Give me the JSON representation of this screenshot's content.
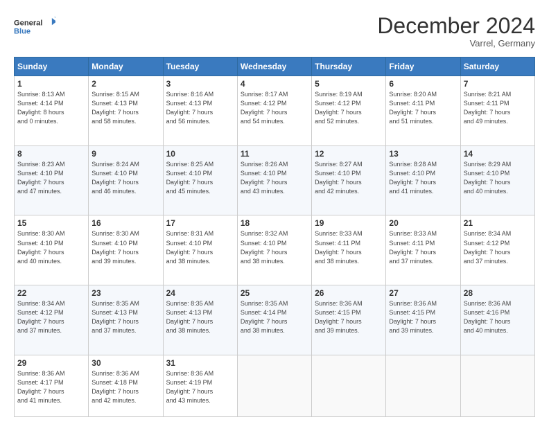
{
  "logo": {
    "line1": "General",
    "line2": "Blue"
  },
  "title": "December 2024",
  "location": "Varrel, Germany",
  "days_header": [
    "Sunday",
    "Monday",
    "Tuesday",
    "Wednesday",
    "Thursday",
    "Friday",
    "Saturday"
  ],
  "weeks": [
    [
      {
        "day": "1",
        "sunrise": "8:13 AM",
        "sunset": "4:14 PM",
        "daylight": "8 hours and 0 minutes."
      },
      {
        "day": "2",
        "sunrise": "8:15 AM",
        "sunset": "4:13 PM",
        "daylight": "7 hours and 58 minutes."
      },
      {
        "day": "3",
        "sunrise": "8:16 AM",
        "sunset": "4:13 PM",
        "daylight": "7 hours and 56 minutes."
      },
      {
        "day": "4",
        "sunrise": "8:17 AM",
        "sunset": "4:12 PM",
        "daylight": "7 hours and 54 minutes."
      },
      {
        "day": "5",
        "sunrise": "8:19 AM",
        "sunset": "4:12 PM",
        "daylight": "7 hours and 52 minutes."
      },
      {
        "day": "6",
        "sunrise": "8:20 AM",
        "sunset": "4:11 PM",
        "daylight": "7 hours and 51 minutes."
      },
      {
        "day": "7",
        "sunrise": "8:21 AM",
        "sunset": "4:11 PM",
        "daylight": "7 hours and 49 minutes."
      }
    ],
    [
      {
        "day": "8",
        "sunrise": "8:23 AM",
        "sunset": "4:10 PM",
        "daylight": "7 hours and 47 minutes."
      },
      {
        "day": "9",
        "sunrise": "8:24 AM",
        "sunset": "4:10 PM",
        "daylight": "7 hours and 46 minutes."
      },
      {
        "day": "10",
        "sunrise": "8:25 AM",
        "sunset": "4:10 PM",
        "daylight": "7 hours and 45 minutes."
      },
      {
        "day": "11",
        "sunrise": "8:26 AM",
        "sunset": "4:10 PM",
        "daylight": "7 hours and 43 minutes."
      },
      {
        "day": "12",
        "sunrise": "8:27 AM",
        "sunset": "4:10 PM",
        "daylight": "7 hours and 42 minutes."
      },
      {
        "day": "13",
        "sunrise": "8:28 AM",
        "sunset": "4:10 PM",
        "daylight": "7 hours and 41 minutes."
      },
      {
        "day": "14",
        "sunrise": "8:29 AM",
        "sunset": "4:10 PM",
        "daylight": "7 hours and 40 minutes."
      }
    ],
    [
      {
        "day": "15",
        "sunrise": "8:30 AM",
        "sunset": "4:10 PM",
        "daylight": "7 hours and 40 minutes."
      },
      {
        "day": "16",
        "sunrise": "8:30 AM",
        "sunset": "4:10 PM",
        "daylight": "7 hours and 39 minutes."
      },
      {
        "day": "17",
        "sunrise": "8:31 AM",
        "sunset": "4:10 PM",
        "daylight": "7 hours and 38 minutes."
      },
      {
        "day": "18",
        "sunrise": "8:32 AM",
        "sunset": "4:10 PM",
        "daylight": "7 hours and 38 minutes."
      },
      {
        "day": "19",
        "sunrise": "8:33 AM",
        "sunset": "4:11 PM",
        "daylight": "7 hours and 38 minutes."
      },
      {
        "day": "20",
        "sunrise": "8:33 AM",
        "sunset": "4:11 PM",
        "daylight": "7 hours and 37 minutes."
      },
      {
        "day": "21",
        "sunrise": "8:34 AM",
        "sunset": "4:12 PM",
        "daylight": "7 hours and 37 minutes."
      }
    ],
    [
      {
        "day": "22",
        "sunrise": "8:34 AM",
        "sunset": "4:12 PM",
        "daylight": "7 hours and 37 minutes."
      },
      {
        "day": "23",
        "sunrise": "8:35 AM",
        "sunset": "4:13 PM",
        "daylight": "7 hours and 37 minutes."
      },
      {
        "day": "24",
        "sunrise": "8:35 AM",
        "sunset": "4:13 PM",
        "daylight": "7 hours and 38 minutes."
      },
      {
        "day": "25",
        "sunrise": "8:35 AM",
        "sunset": "4:14 PM",
        "daylight": "7 hours and 38 minutes."
      },
      {
        "day": "26",
        "sunrise": "8:36 AM",
        "sunset": "4:15 PM",
        "daylight": "7 hours and 39 minutes."
      },
      {
        "day": "27",
        "sunrise": "8:36 AM",
        "sunset": "4:15 PM",
        "daylight": "7 hours and 39 minutes."
      },
      {
        "day": "28",
        "sunrise": "8:36 AM",
        "sunset": "4:16 PM",
        "daylight": "7 hours and 40 minutes."
      }
    ],
    [
      {
        "day": "29",
        "sunrise": "8:36 AM",
        "sunset": "4:17 PM",
        "daylight": "7 hours and 41 minutes."
      },
      {
        "day": "30",
        "sunrise": "8:36 AM",
        "sunset": "4:18 PM",
        "daylight": "7 hours and 42 minutes."
      },
      {
        "day": "31",
        "sunrise": "8:36 AM",
        "sunset": "4:19 PM",
        "daylight": "7 hours and 43 minutes."
      },
      null,
      null,
      null,
      null
    ]
  ],
  "labels": {
    "sunrise": "Sunrise:",
    "sunset": "Sunset:",
    "daylight": "Daylight:"
  }
}
